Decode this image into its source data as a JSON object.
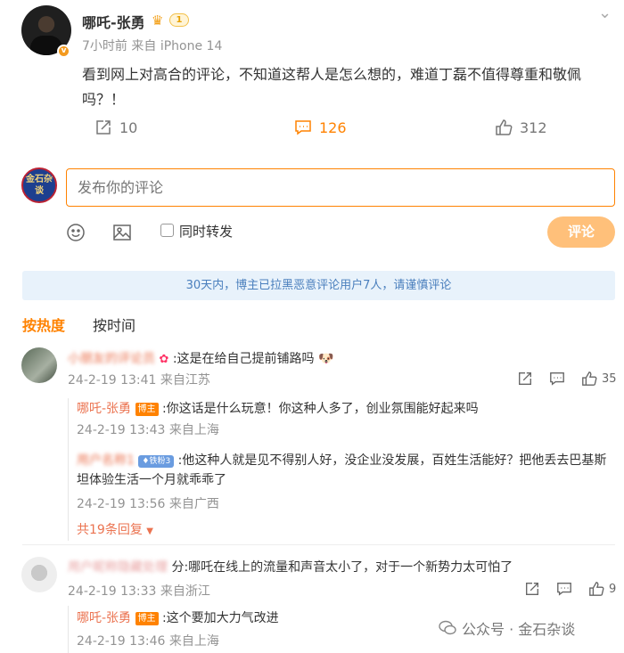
{
  "post": {
    "author": "哪吒-张勇",
    "level": "1",
    "time": "7小时前",
    "source_prefix": "来自",
    "source": "iPhone 14",
    "text": "看到网上对高合的评论，不知道这帮人是怎么想的，难道丁磊不值得尊重和敬佩吗？！",
    "reposts": "10",
    "comments": "126",
    "likes": "312"
  },
  "composer": {
    "avatar_text": "金石杂谈",
    "placeholder": "发布你的评论",
    "repost_label": "同时转发",
    "submit_label": "评论"
  },
  "notice": "30天内，博主已拉黑恶意评论用户7人，请谨慎评论",
  "sort": {
    "hot": "按热度",
    "time": "按时间"
  },
  "comments": [
    {
      "user_blurred": "小朋友的评论员",
      "text": ":这是在给自己提前铺路吗",
      "time": "24-2-19 13:41",
      "location": "来自江苏",
      "likes": "35",
      "replies": [
        {
          "user": "哪吒-张勇",
          "tag": "博主",
          "text": ":你这话是什么玩意！你这种人多了，创业氛围能好起来吗",
          "time": "24-2-19 13:43",
          "location": "来自上海"
        },
        {
          "user_blurred": "用户名称1",
          "tag": "铁粉3",
          "text": ":他这种人就是见不得别人好，没企业没发展，百姓生活能好？把他丢去巴基斯坦体验生活一个月就乖乖了",
          "time": "24-2-19 13:56",
          "location": "来自广西"
        }
      ],
      "more_replies": "共19条回复"
    },
    {
      "user_blurred": "用户昵称隐藏处理",
      "text": "分:哪吒在线上的流量和声音太小了，对于一个新势力太可怕了",
      "time": "24-2-19 13:33",
      "location": "来自浙江",
      "likes": "9",
      "replies": [
        {
          "user": "哪吒-张勇",
          "tag": "博主",
          "text": ":这个要加大力气改进",
          "time": "24-2-19 13:46",
          "location": "来自上海"
        }
      ]
    }
  ],
  "watermark": "公众号 · 金石杂谈",
  "colors": {
    "accent": "#ff8200",
    "name": "#eb7350",
    "notice_bg": "#e8f2fb",
    "notice_text": "#4a7fbd"
  }
}
